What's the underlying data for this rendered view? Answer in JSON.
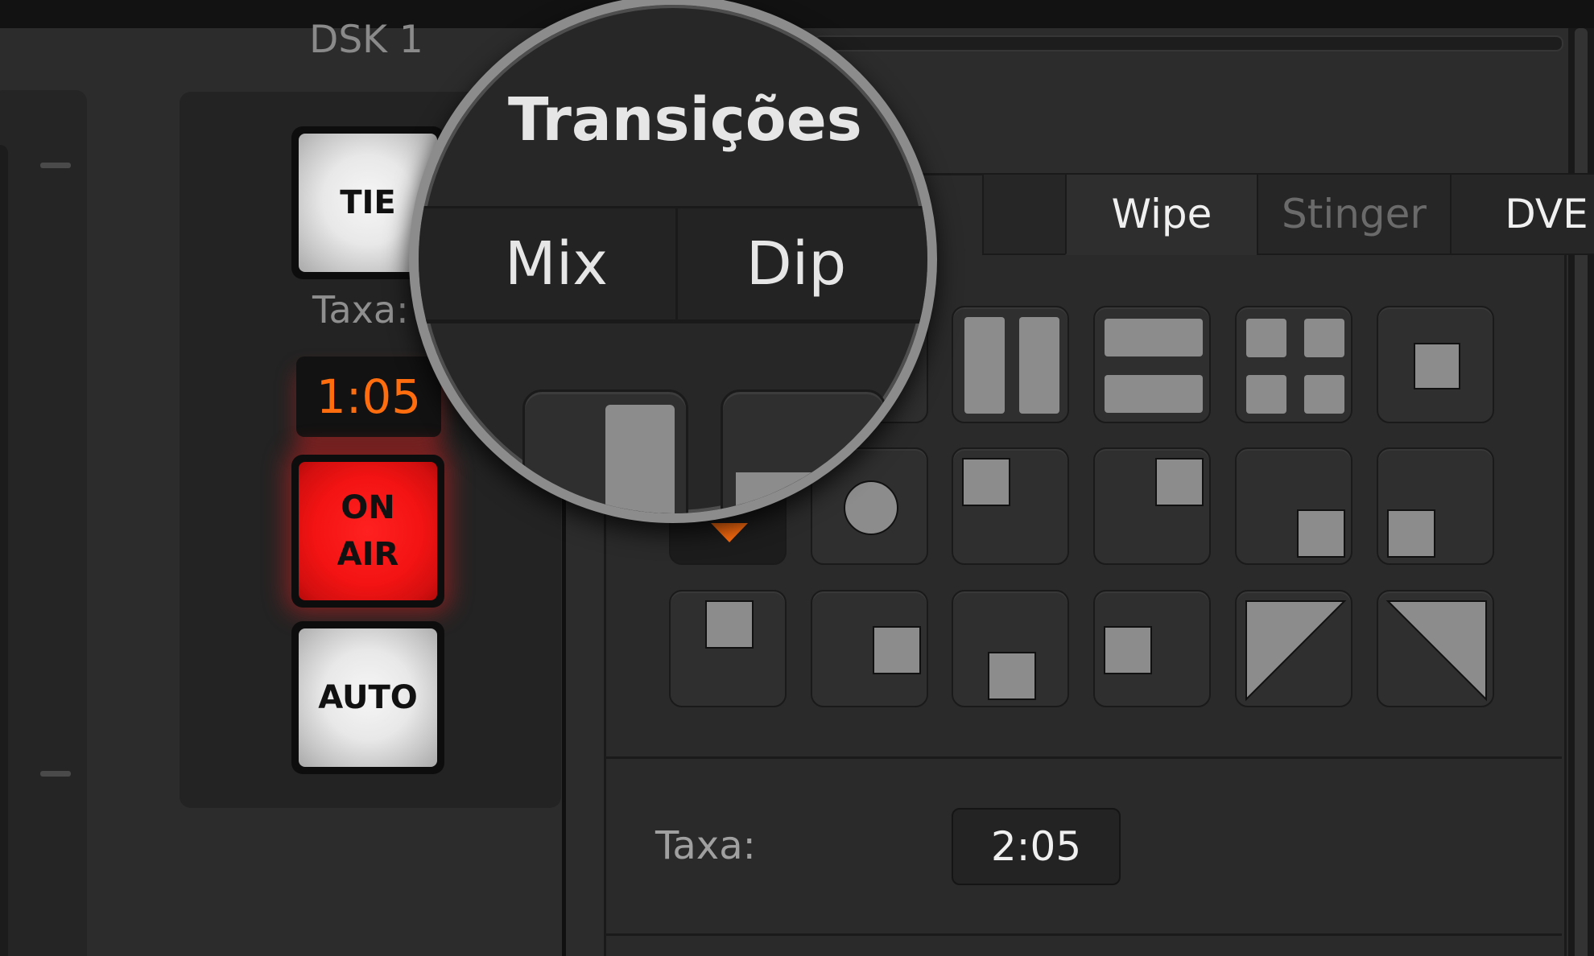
{
  "dsk": {
    "title": "DSK 1",
    "tie_label": "TIE",
    "rate_label": "Taxa:",
    "rate_value": "1:05",
    "onair_line1": "ON",
    "onair_line2": "AIR",
    "auto_label": "AUTO"
  },
  "transitions": {
    "title": "Transições",
    "tabs": [
      {
        "label": "Mix",
        "active": false
      },
      {
        "label": "Dip",
        "active": false
      },
      {
        "label": "Wipe",
        "active": true
      },
      {
        "label": "Stinger",
        "active": false,
        "disabled": true
      },
      {
        "label": "DVE",
        "active": false
      }
    ],
    "patterns": [
      "horizontal-wipe-pattern-icon",
      "vertical-wipe-pattern-icon",
      "horizontal-barn-door-pattern-icon",
      "vertical-barn-door-pattern-icon",
      "corner-box-pattern-icon",
      "box-iris-pattern-icon",
      "diamond-iris-pattern-icon",
      "circle-iris-pattern-icon",
      "box-top-left-pattern-icon",
      "box-top-right-pattern-icon",
      "box-bottom-right-pattern-icon",
      "box-bottom-left-pattern-icon",
      "box-top-centre-pattern-icon",
      "box-right-centre-pattern-icon",
      "box-bottom-centre-pattern-icon",
      "box-left-centre-pattern-icon",
      "top-left-diagonal-pattern-icon",
      "top-right-diagonal-pattern-icon"
    ],
    "selected_pattern": "diamond-iris-pattern-icon",
    "rate_label": "Taxa:",
    "rate_value": "2:05"
  },
  "colors": {
    "accent_orange": "#ff6d0f",
    "onair_red": "#f31313",
    "panel_bg": "#2c2c2c"
  }
}
